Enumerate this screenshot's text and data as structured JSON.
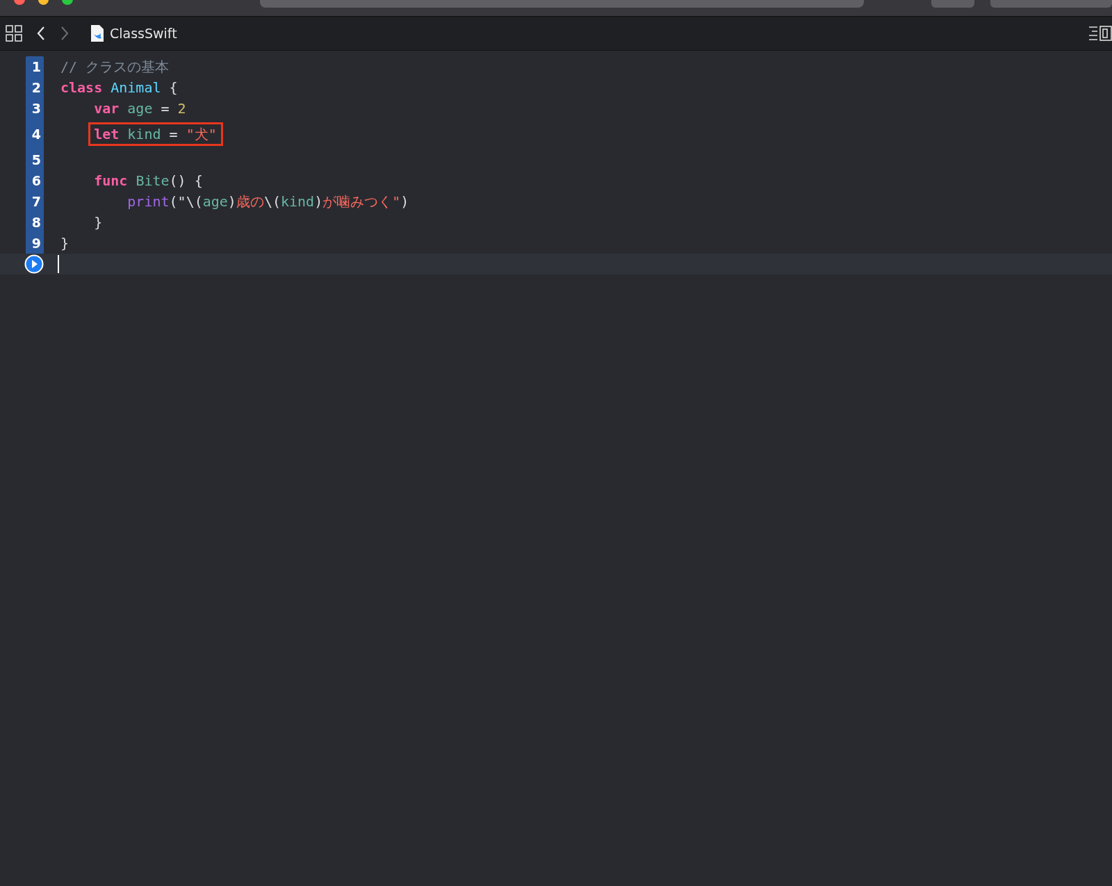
{
  "toolbar": {
    "back_enabled": true,
    "forward_enabled": false,
    "file_name": "ClassSwift"
  },
  "lines": [
    {
      "number": "1",
      "tokens": [
        {
          "kind": "comment",
          "text": "// クラスの基本"
        }
      ]
    },
    {
      "number": "2",
      "tokens": [
        {
          "kind": "keyword",
          "text": "class "
        },
        {
          "kind": "type",
          "text": "Animal "
        },
        {
          "kind": "plain",
          "text": "{"
        }
      ]
    },
    {
      "number": "3",
      "tokens": [
        {
          "kind": "keyword",
          "text": "    var "
        },
        {
          "kind": "ident",
          "text": "age "
        },
        {
          "kind": "plain",
          "text": "= "
        },
        {
          "kind": "number",
          "text": "2"
        }
      ]
    },
    {
      "number": "4",
      "boxed": true,
      "tokens": [
        {
          "kind": "keyword",
          "text": "let "
        },
        {
          "kind": "ident",
          "text": "kind "
        },
        {
          "kind": "plain",
          "text": "= "
        },
        {
          "kind": "string",
          "text": "\"犬\""
        }
      ]
    },
    {
      "number": "5"
    },
    {
      "number": "6",
      "tokens": [
        {
          "kind": "keyword",
          "text": "    func "
        },
        {
          "kind": "ident",
          "text": "Bite"
        },
        {
          "kind": "plain",
          "text": "() {"
        }
      ]
    },
    {
      "number": "7",
      "tokens": [
        {
          "kind": "call",
          "text": "        print"
        },
        {
          "kind": "plain",
          "text": "(\"\\("
        },
        {
          "kind": "interp",
          "text": "age"
        },
        {
          "kind": "plain",
          "text": ")"
        },
        {
          "kind": "string",
          "text": "歳の"
        },
        {
          "kind": "plain",
          "text": "\\("
        },
        {
          "kind": "interp",
          "text": "kind"
        },
        {
          "kind": "plain",
          "text": ")"
        },
        {
          "kind": "string",
          "text": "が噛みつく\""
        },
        {
          "kind": "plain",
          "text": ")"
        }
      ]
    },
    {
      "number": "8",
      "tokens": [
        {
          "kind": "plain",
          "text": "    }"
        }
      ]
    },
    {
      "number": "9",
      "tokens": [
        {
          "kind": "plain",
          "text": "}"
        }
      ]
    }
  ]
}
